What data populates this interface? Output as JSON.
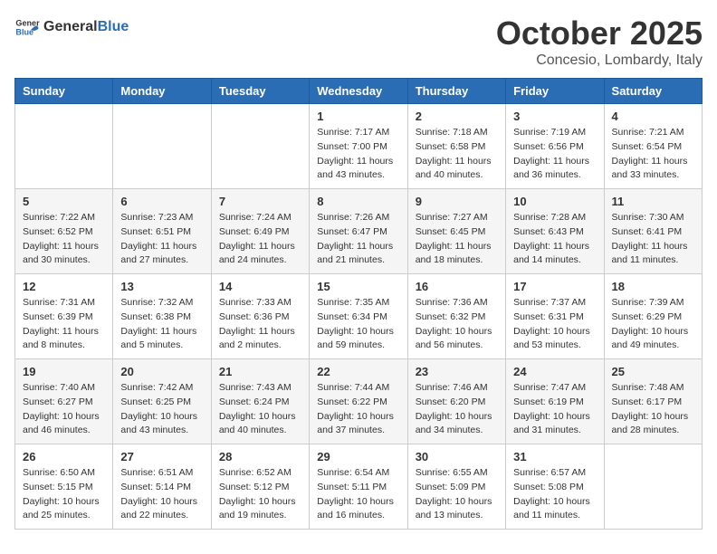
{
  "header": {
    "logo_general": "General",
    "logo_blue": "Blue",
    "month_title": "October 2025",
    "location": "Concesio, Lombardy, Italy"
  },
  "days_of_week": [
    "Sunday",
    "Monday",
    "Tuesday",
    "Wednesday",
    "Thursday",
    "Friday",
    "Saturday"
  ],
  "weeks": [
    [
      {
        "day": "",
        "info": ""
      },
      {
        "day": "",
        "info": ""
      },
      {
        "day": "",
        "info": ""
      },
      {
        "day": "1",
        "info": "Sunrise: 7:17 AM\nSunset: 7:00 PM\nDaylight: 11 hours\nand 43 minutes."
      },
      {
        "day": "2",
        "info": "Sunrise: 7:18 AM\nSunset: 6:58 PM\nDaylight: 11 hours\nand 40 minutes."
      },
      {
        "day": "3",
        "info": "Sunrise: 7:19 AM\nSunset: 6:56 PM\nDaylight: 11 hours\nand 36 minutes."
      },
      {
        "day": "4",
        "info": "Sunrise: 7:21 AM\nSunset: 6:54 PM\nDaylight: 11 hours\nand 33 minutes."
      }
    ],
    [
      {
        "day": "5",
        "info": "Sunrise: 7:22 AM\nSunset: 6:52 PM\nDaylight: 11 hours\nand 30 minutes."
      },
      {
        "day": "6",
        "info": "Sunrise: 7:23 AM\nSunset: 6:51 PM\nDaylight: 11 hours\nand 27 minutes."
      },
      {
        "day": "7",
        "info": "Sunrise: 7:24 AM\nSunset: 6:49 PM\nDaylight: 11 hours\nand 24 minutes."
      },
      {
        "day": "8",
        "info": "Sunrise: 7:26 AM\nSunset: 6:47 PM\nDaylight: 11 hours\nand 21 minutes."
      },
      {
        "day": "9",
        "info": "Sunrise: 7:27 AM\nSunset: 6:45 PM\nDaylight: 11 hours\nand 18 minutes."
      },
      {
        "day": "10",
        "info": "Sunrise: 7:28 AM\nSunset: 6:43 PM\nDaylight: 11 hours\nand 14 minutes."
      },
      {
        "day": "11",
        "info": "Sunrise: 7:30 AM\nSunset: 6:41 PM\nDaylight: 11 hours\nand 11 minutes."
      }
    ],
    [
      {
        "day": "12",
        "info": "Sunrise: 7:31 AM\nSunset: 6:39 PM\nDaylight: 11 hours\nand 8 minutes."
      },
      {
        "day": "13",
        "info": "Sunrise: 7:32 AM\nSunset: 6:38 PM\nDaylight: 11 hours\nand 5 minutes."
      },
      {
        "day": "14",
        "info": "Sunrise: 7:33 AM\nSunset: 6:36 PM\nDaylight: 11 hours\nand 2 minutes."
      },
      {
        "day": "15",
        "info": "Sunrise: 7:35 AM\nSunset: 6:34 PM\nDaylight: 10 hours\nand 59 minutes."
      },
      {
        "day": "16",
        "info": "Sunrise: 7:36 AM\nSunset: 6:32 PM\nDaylight: 10 hours\nand 56 minutes."
      },
      {
        "day": "17",
        "info": "Sunrise: 7:37 AM\nSunset: 6:31 PM\nDaylight: 10 hours\nand 53 minutes."
      },
      {
        "day": "18",
        "info": "Sunrise: 7:39 AM\nSunset: 6:29 PM\nDaylight: 10 hours\nand 49 minutes."
      }
    ],
    [
      {
        "day": "19",
        "info": "Sunrise: 7:40 AM\nSunset: 6:27 PM\nDaylight: 10 hours\nand 46 minutes."
      },
      {
        "day": "20",
        "info": "Sunrise: 7:42 AM\nSunset: 6:25 PM\nDaylight: 10 hours\nand 43 minutes."
      },
      {
        "day": "21",
        "info": "Sunrise: 7:43 AM\nSunset: 6:24 PM\nDaylight: 10 hours\nand 40 minutes."
      },
      {
        "day": "22",
        "info": "Sunrise: 7:44 AM\nSunset: 6:22 PM\nDaylight: 10 hours\nand 37 minutes."
      },
      {
        "day": "23",
        "info": "Sunrise: 7:46 AM\nSunset: 6:20 PM\nDaylight: 10 hours\nand 34 minutes."
      },
      {
        "day": "24",
        "info": "Sunrise: 7:47 AM\nSunset: 6:19 PM\nDaylight: 10 hours\nand 31 minutes."
      },
      {
        "day": "25",
        "info": "Sunrise: 7:48 AM\nSunset: 6:17 PM\nDaylight: 10 hours\nand 28 minutes."
      }
    ],
    [
      {
        "day": "26",
        "info": "Sunrise: 6:50 AM\nSunset: 5:15 PM\nDaylight: 10 hours\nand 25 minutes."
      },
      {
        "day": "27",
        "info": "Sunrise: 6:51 AM\nSunset: 5:14 PM\nDaylight: 10 hours\nand 22 minutes."
      },
      {
        "day": "28",
        "info": "Sunrise: 6:52 AM\nSunset: 5:12 PM\nDaylight: 10 hours\nand 19 minutes."
      },
      {
        "day": "29",
        "info": "Sunrise: 6:54 AM\nSunset: 5:11 PM\nDaylight: 10 hours\nand 16 minutes."
      },
      {
        "day": "30",
        "info": "Sunrise: 6:55 AM\nSunset: 5:09 PM\nDaylight: 10 hours\nand 13 minutes."
      },
      {
        "day": "31",
        "info": "Sunrise: 6:57 AM\nSunset: 5:08 PM\nDaylight: 10 hours\nand 11 minutes."
      },
      {
        "day": "",
        "info": ""
      }
    ]
  ]
}
